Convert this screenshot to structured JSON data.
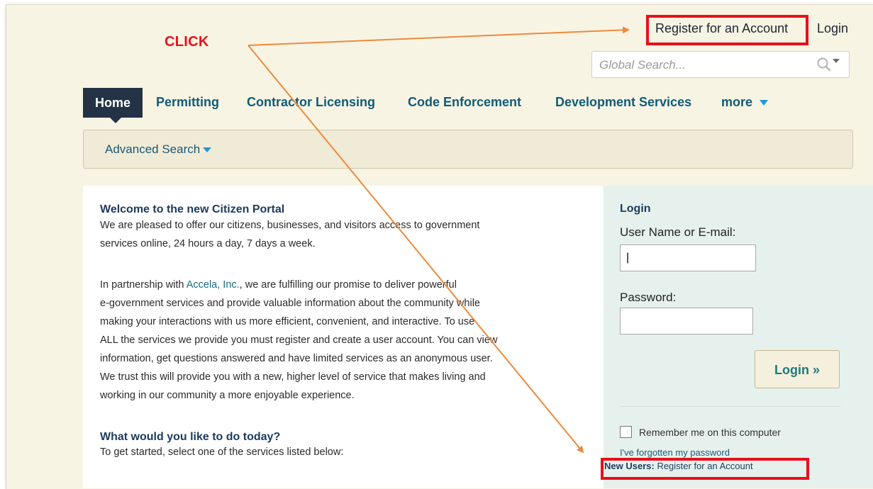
{
  "annotation": {
    "click_label": "CLICK"
  },
  "header": {
    "register_link": "Register for an Account",
    "login_link": "Login",
    "search_placeholder": "Global Search..."
  },
  "nav": {
    "tabs": [
      {
        "label": "Home",
        "active": true
      },
      {
        "label": "Permitting"
      },
      {
        "label": "Contractor Licensing"
      },
      {
        "label": "Code Enforcement"
      },
      {
        "label": "Development Services"
      },
      {
        "label": "more"
      }
    ],
    "advanced_search": "Advanced Search"
  },
  "main": {
    "welcome_title": "Welcome to the new Citizen Portal",
    "welcome_lines": [
      "We are pleased to offer our citizens, businesses, and visitors access to government",
      "services online, 24 hours a day, 7 days a week."
    ],
    "partnership": {
      "prefix": "In partnership with ",
      "accela": "Accela, Inc.",
      "line1_suffix": ", we are fulfilling our promise to deliver powerful",
      "lines": [
        "e-government services and provide valuable information about the community while",
        "making your interactions with us more efficient, convenient, and interactive. To use",
        "ALL the services we provide you must register and create a user account. You can view",
        "information, get questions answered and have limited services as an anonymous user.",
        "We trust this will provide you with a new, higher level of service that makes living and",
        "working in our community a more enjoyable experience."
      ]
    },
    "todo_title": "What would you like to do today?",
    "todo_text": "To get started, select one of the services listed below:"
  },
  "login_panel": {
    "title": "Login",
    "username_label": "User Name or E-mail:",
    "username_value": "|",
    "password_label": "Password:",
    "password_value": "",
    "button": "Login »",
    "remember": "Remember me on this computer",
    "forgot": "I've forgotten my password",
    "new_users_label": "New Users:",
    "new_users_link": "Register for an Account"
  },
  "colors": {
    "highlight": "#e8101a",
    "arrow": "#ee8a3a",
    "nav_text": "#0f5b78",
    "active_tab_bg": "#233245",
    "page_bg": "#f8f4e4",
    "login_panel_bg": "#e6f1ed"
  }
}
